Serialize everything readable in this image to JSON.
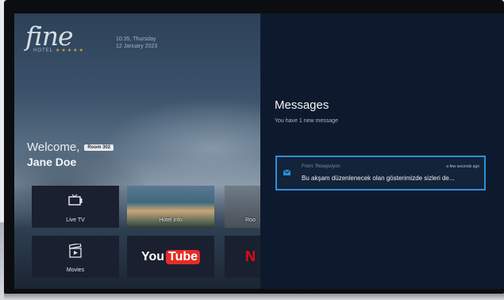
{
  "hotel": {
    "logo_text": "fine",
    "logo_sub": "HOTEL",
    "logo_stars": "★★★★★",
    "time": "10:35, Thursday",
    "date": "12 January 2023"
  },
  "welcome": {
    "label": "Welcome,",
    "room_badge": "Room 302",
    "guest_name": "Jane Doe"
  },
  "tiles": [
    {
      "label": "Live TV",
      "icon": "tv-icon"
    },
    {
      "label": "Hotel info",
      "icon": "hotel-photo"
    },
    {
      "label": "Roo",
      "icon": "room-photo"
    },
    {
      "label": "Movies",
      "icon": "clapperboard-icon"
    },
    {
      "label": "YouTube",
      "icon": "youtube-logo"
    },
    {
      "label": "N",
      "icon": "netflix-logo"
    }
  ],
  "youtube": {
    "you": "You",
    "tube": "Tube"
  },
  "netflix": {
    "text": "N"
  },
  "messages": {
    "title": "Messages",
    "subtitle": "You have 1 new message",
    "items": [
      {
        "from": "From: Resepsiyon",
        "time": "a few seconds ago",
        "text": "Bu akşam düzenlenecek olan gösterimizde sizleri de..."
      }
    ]
  },
  "colors": {
    "accent": "#2f8fd8",
    "panel": "#0d1a2d",
    "youtube_red": "#e52d27",
    "netflix_red": "#e50914"
  }
}
